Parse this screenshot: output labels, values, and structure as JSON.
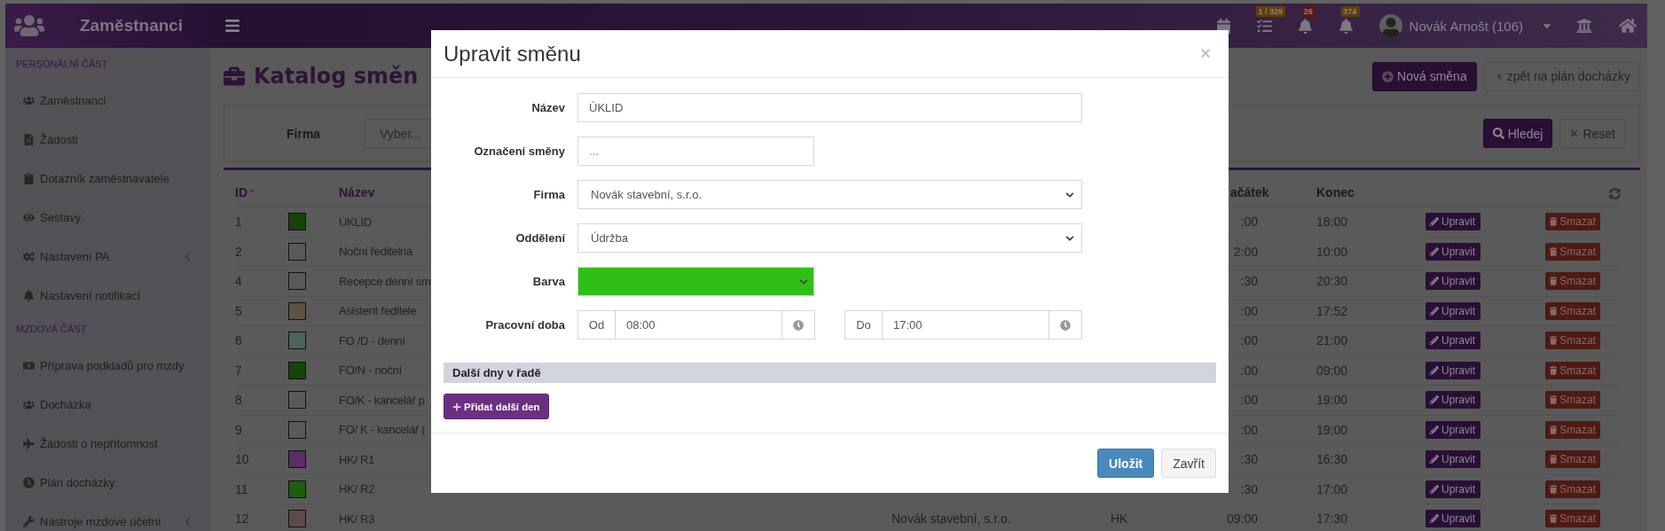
{
  "header": {
    "app_title": "Zaměstnanci",
    "notifications": [
      {
        "kind": "calendar"
      },
      {
        "kind": "tasks",
        "count": "1 / 329",
        "color": "#5f400a"
      },
      {
        "kind": "bell",
        "count": "26",
        "color": "#5a1a14"
      },
      {
        "kind": "bells",
        "count": "374",
        "color": "#5f400a"
      }
    ],
    "user": "Novák Arnošt (106)"
  },
  "sidebar": [
    {
      "heading": "PERSONÁLNÍ ČÁST",
      "items": [
        {
          "label": "Zaměstnanci",
          "kind": "users",
          "submenu": false
        },
        {
          "label": "Žádosti",
          "kind": "file",
          "submenu": false
        },
        {
          "label": "Dotazník zaměstnavatele",
          "kind": "clipboard",
          "submenu": false
        },
        {
          "label": "Sestavy",
          "kind": "eye",
          "submenu": false
        },
        {
          "label": "Nastavení PA",
          "kind": "cogs",
          "submenu": true
        },
        {
          "label": "Nastavení notifikací",
          "kind": "bell",
          "submenu": false
        }
      ]
    },
    {
      "heading": "MZDOVÁ ČÁST",
      "items": [
        {
          "label": "Příprava podkladů pro mzdy",
          "kind": "money",
          "submenu": false
        },
        {
          "label": "Docházka",
          "kind": "users",
          "submenu": false
        },
        {
          "label": "Žádosti o nepřítomnost",
          "kind": "plane",
          "submenu": false
        },
        {
          "label": "Plán docházky",
          "kind": "clock",
          "submenu": false
        },
        {
          "label": "Nástroje mzdové účetní",
          "kind": "wrench",
          "submenu": true
        }
      ]
    }
  ],
  "page": {
    "title": "Katalog směn",
    "actions": [
      {
        "label": "Nová směna",
        "kind": "primary"
      },
      {
        "label": "zpět na plán docházky",
        "kind": "back"
      }
    ]
  },
  "filter": {
    "label": "Firma",
    "placeholder": "Vyber...",
    "buttons": [
      {
        "label": "Hledej",
        "kind": "search"
      },
      {
        "label": "Reset",
        "kind": "reset"
      }
    ]
  },
  "table": {
    "columns": [
      {
        "label": "ID",
        "sorted": true
      },
      {
        "label": "Název",
        "sorted": false
      },
      {
        "label": "ačátek",
        "sorted": false
      },
      {
        "label": "Konec",
        "sorted": false
      }
    ],
    "rows": [
      {
        "id": "1",
        "color": "#17430b",
        "name": "ÚKLID",
        "start": ":00",
        "end": "18:00",
        "edit": "Upravit",
        "delete": "Smazat"
      },
      {
        "id": "2",
        "color": "#5a5a5a",
        "name": "Noční ředitelna",
        "start": "2:00",
        "end": "10:00",
        "edit": "Upravit",
        "delete": "Smazat"
      },
      {
        "id": "4",
        "color": "#5a5a5a",
        "name": "Recepce denní sm",
        "start": ":30",
        "end": "20:30",
        "edit": "Upravit",
        "delete": "Smazat"
      },
      {
        "id": "5",
        "color": "#5e5247",
        "name": "Asistent ředitele",
        "start": ":00",
        "end": "17:52",
        "edit": "Upravit",
        "delete": "Smazat"
      },
      {
        "id": "6",
        "color": "#4c6360",
        "name": "FO /D - denní",
        "start": ":00",
        "end": "21:00",
        "edit": "Upravit",
        "delete": "Smazat"
      },
      {
        "id": "7",
        "color": "#17430b",
        "name": "FO/N - noční",
        "start": ":00",
        "end": "09:00",
        "edit": "Upravit",
        "delete": "Smazat"
      },
      {
        "id": "8",
        "color": "#5a5a5a",
        "name": "FO/K - kancelář p",
        "start": ":00",
        "end": "19:00",
        "edit": "Upravit",
        "delete": "Smazat"
      },
      {
        "id": "9",
        "color": "#5a5a5a",
        "name": "FO/ K - kancelář (",
        "start": ":00",
        "end": "19:00",
        "edit": "Upravit",
        "delete": "Smazat"
      },
      {
        "id": "10",
        "color": "#5a2e66",
        "name": "HK/ R1",
        "start": ":30",
        "end": "16:30",
        "edit": "Upravit",
        "delete": "Smazat"
      },
      {
        "id": "11",
        "color": "#1e5c0f",
        "name": "HK/ R2",
        "start": ":30",
        "end": "17:00",
        "edit": "Upravit",
        "delete": "Smazat"
      },
      {
        "id": "12",
        "color": "#5e4a4a",
        "name": "HK/ R3",
        "company": "Novák stavební, s.r.o.",
        "department": "HK",
        "start": "09:00",
        "end": "17:30",
        "edit": "Upravit",
        "delete": "Smazat"
      }
    ]
  },
  "modal": {
    "title": "Upravit směnu",
    "close": "×",
    "fields": [
      {
        "label": "Název",
        "kind": "text",
        "value": "ÚKLID"
      },
      {
        "label": "Označení směny",
        "kind": "short",
        "placeholder": "..."
      },
      {
        "label": "Firma",
        "kind": "select",
        "value": "Novák stavební, s.r.o."
      },
      {
        "label": "Oddělení",
        "kind": "select",
        "value": "Údržba"
      },
      {
        "label": "Barva",
        "kind": "color",
        "color": "#2fbf16"
      },
      {
        "label": "Pracovní doba",
        "kind": "time",
        "ranges": [
          {
            "prefix": "Od",
            "value": "08:00"
          },
          {
            "prefix": "Do",
            "value": "17:00"
          }
        ]
      }
    ],
    "section": "Další dny v řadě",
    "add_button": "Přidat další den",
    "buttons": [
      {
        "label": "Uložit",
        "kind": "primary"
      },
      {
        "label": "Zavřít",
        "kind": "default"
      }
    ]
  }
}
